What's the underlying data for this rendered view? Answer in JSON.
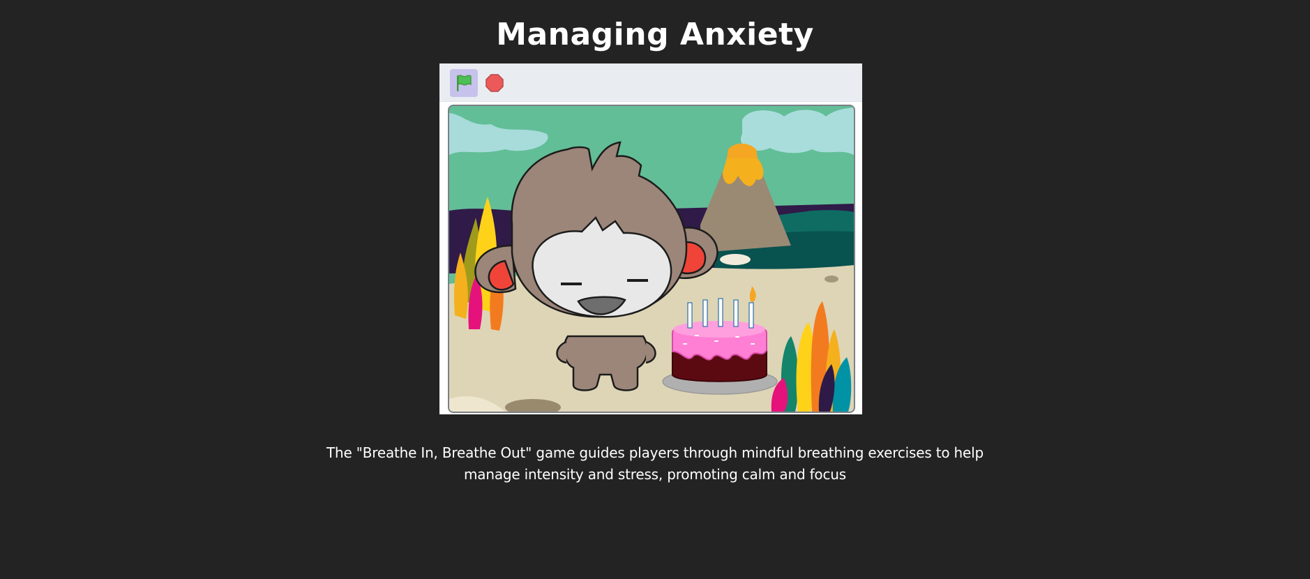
{
  "page": {
    "title": "Managing Anxiety",
    "description": "The \"Breathe In, Breathe Out\" game guides players through mindful breathing exercises to help manage intensity and stress, promoting calm and focus"
  },
  "player": {
    "controls": [
      {
        "name": "green-flag",
        "icon": "green-flag-icon",
        "state": "active"
      },
      {
        "name": "stop",
        "icon": "stop-sign-icon"
      }
    ],
    "stage": {
      "scene": "birthday-party-outdoors",
      "sprites": [
        "character-sprite",
        "birthday-cake-sprite"
      ]
    }
  },
  "colors": {
    "background": "#232323",
    "flag_button_bg": "#c6c2ec",
    "flag_green": "#4cbf56",
    "stop_red": "#ec5959",
    "stage_border": "#7a7f86"
  }
}
